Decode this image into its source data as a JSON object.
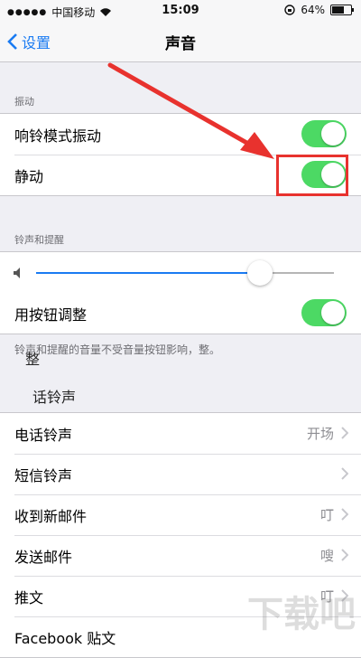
{
  "status_bar": {
    "carrier": "中国移动",
    "time": "15:09",
    "battery": "64%",
    "battery_level": 0.64
  },
  "nav": {
    "back_label": "设置",
    "title": "声音"
  },
  "vibration": {
    "header": "振动",
    "ring_label": "响铃模式振动",
    "silent_label": "静动"
  },
  "ringer": {
    "header": "铃声和提醒",
    "volume_level": 0.75,
    "buttons_label": "用按钮调整",
    "footnote": "铃声和提醒的音量不受音量按钮影响，整。"
  },
  "overlay_texts": {
    "frag_a": "整",
    "frag_b": "话铃声"
  },
  "sounds": {
    "items": [
      {
        "label": "电话铃声",
        "value": "开场"
      },
      {
        "label": "短信铃声",
        "value": ""
      },
      {
        "label": "收到新邮件",
        "value": "叮"
      },
      {
        "label": "发送邮件",
        "value": "嗖"
      },
      {
        "label": "推文",
        "value": "叮"
      },
      {
        "label": "Facebook 贴文",
        "value": ""
      }
    ]
  },
  "colors": {
    "accent": "#1a7bf2",
    "toggle_on": "#4cd964",
    "highlight": "#e8322e"
  },
  "watermark": "下载吧"
}
